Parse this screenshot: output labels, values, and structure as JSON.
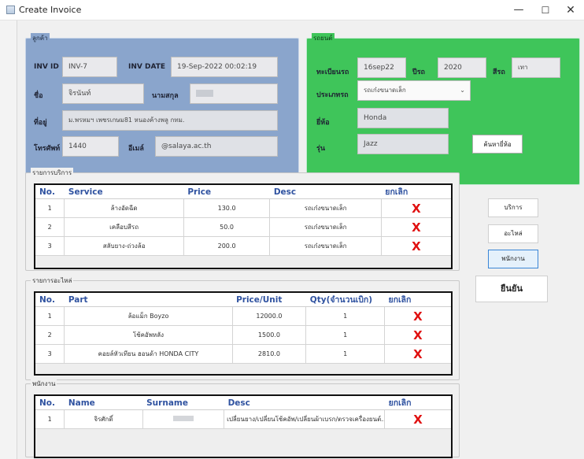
{
  "window": {
    "title": "Create Invoice",
    "controls": [
      "—",
      "☐",
      "✕"
    ]
  },
  "customer": {
    "group_label": "ลูกค้า",
    "inv_id_label": "INV ID",
    "inv_id": "INV-7",
    "inv_date_label": "INV DATE",
    "inv_date": "19-Sep-2022  00:02:19",
    "name_label": "ชื่อ",
    "name": "จิรนันท์",
    "surname_label": "นามสกุล",
    "surname": "",
    "address_label": "ที่อยู่",
    "address": "ม.พรหมฯ เพชรเกษม81 หนองค้างพลู กทม.",
    "phone_label": "โทรศัพท์",
    "phone": "1440",
    "email_label": "อีเมล์",
    "email": "@salaya.ac.th"
  },
  "car": {
    "group_label": "รถยนต์",
    "plate_label": "ทะเบียนรถ",
    "plate": "16sep22",
    "year_label": "ปีรถ",
    "year": "2020",
    "color_label": "สีรถ",
    "color": "เทา",
    "type_label": "ประเภทรถ",
    "type": "รถเก๋งขนาดเล็ก",
    "brand_label": "ยี่ห้อ",
    "brand": "Honda",
    "model_label": "รุ่น",
    "model": "Jazz",
    "search_button": "ค้นหายี่ห้อ"
  },
  "services": {
    "group_label": "รายการบริการ",
    "headers": [
      "No.",
      "Service",
      "Price",
      "Desc",
      "ยกเลิก"
    ],
    "rows": [
      {
        "no": "1",
        "service": "ล้างอัดฉีด",
        "price": "130.0",
        "desc": "รถเก๋งขนาดเล็ก",
        "cancel": "X"
      },
      {
        "no": "2",
        "service": "เคลือบสีรถ",
        "price": "50.0",
        "desc": "รถเก๋งขนาดเล็ก",
        "cancel": "X"
      },
      {
        "no": "3",
        "service": "สลับยาง-ถ่วงล้อ",
        "price": "200.0",
        "desc": "รถเก๋งขนาดเล็ก",
        "cancel": "X"
      }
    ]
  },
  "parts": {
    "group_label": "รายการอะไหล่",
    "headers": [
      "No.",
      "Part",
      "Price/Unit",
      "Qty(จำนวนเบิก)",
      "ยกเลิก"
    ],
    "rows": [
      {
        "no": "1",
        "part": "ล้อแม็ก Boyzo",
        "price": "12000.0",
        "qty": "1",
        "cancel": "X"
      },
      {
        "no": "2",
        "part": "โช้คอัพหลัง",
        "price": "1500.0",
        "qty": "1",
        "cancel": "X"
      },
      {
        "no": "3",
        "part": "คอยล์หัวเทียน ฮอนด้า HONDA CITY",
        "price": "2810.0",
        "qty": "1",
        "cancel": "X"
      }
    ]
  },
  "employees": {
    "group_label": "พนักงาน",
    "headers": [
      "No.",
      "Name",
      "Surname",
      "Desc",
      "ยกเลิก"
    ],
    "rows": [
      {
        "no": "1",
        "name": "จิรศักดิ์",
        "surname": "",
        "desc": "เปลี่ยนยาง/เปลี่ยนโช้คอัพ/เปลี่ยนผ้าเบรก/ตรวจเครื่องยนต์...",
        "cancel": "X"
      }
    ]
  },
  "side_buttons": {
    "service": "บริการ",
    "parts": "อะไหล่",
    "employee": "พนักงาน",
    "confirm": "ยืนยัน"
  }
}
